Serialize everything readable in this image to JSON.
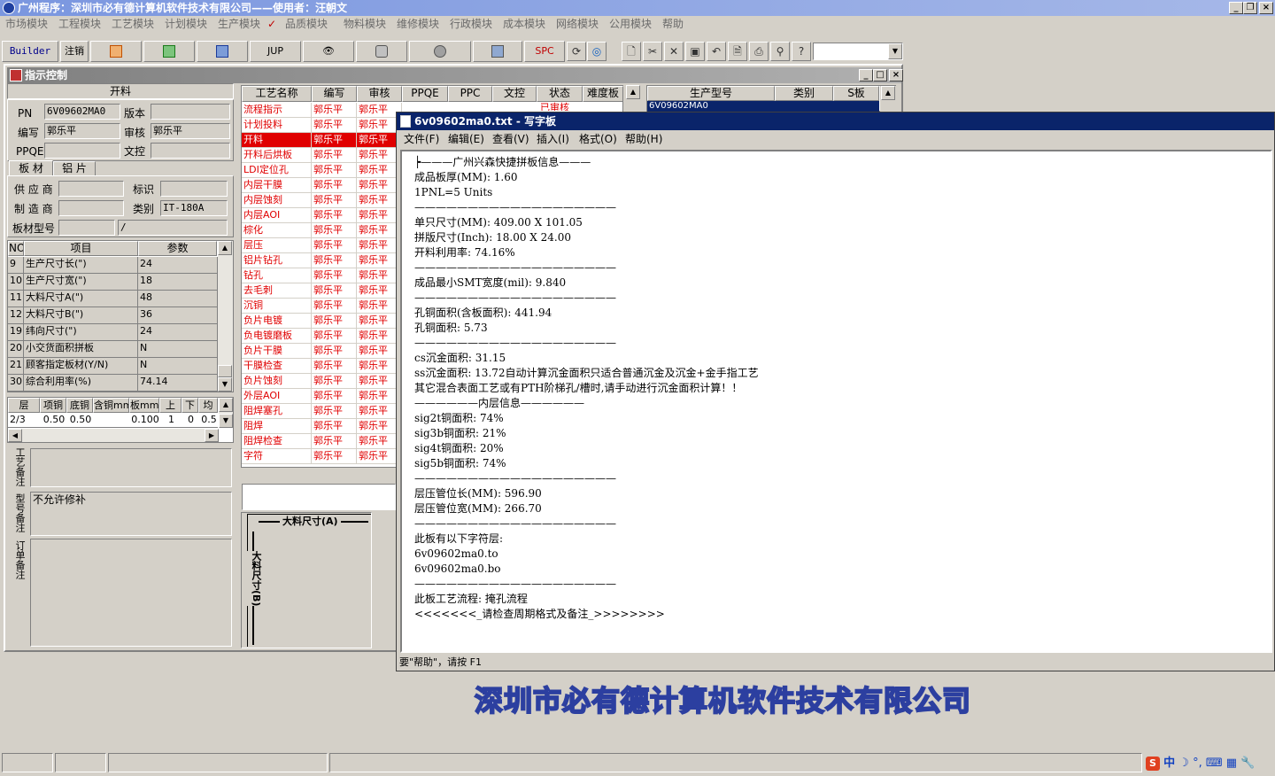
{
  "app": {
    "title": "广州程序：深圳市必有德计算机软件技术有限公司——使用者：汪朝文",
    "menu": [
      "市场模块",
      "工程模块",
      "工艺模块",
      "计划模块",
      "生产模块",
      "品质模块",
      "物料模块",
      "维修模块",
      "行政模块",
      "成本模块",
      "网络模块",
      "公用模块",
      "帮助"
    ]
  },
  "toolbar": {
    "builder_label": "Builder",
    "logout_label": "注销",
    "jup_label": "JUP",
    "spc_label": "SPC"
  },
  "child_window": {
    "title": "指示控制",
    "section_header": "开料",
    "pn_label": "PN",
    "pn_value": "6V09602MA0",
    "version_label": "版本",
    "version_value": "",
    "editor_label": "编写",
    "editor_value": "郭乐平",
    "reviewer_label": "审核",
    "reviewer_value": "郭乐平",
    "ppqe_label": "PPQE",
    "ppqe_value": "",
    "docctrl_label": "文控",
    "docctrl_value": "",
    "tab_board": "板 材",
    "tab_aluminum": "铝 片",
    "supplier_label": "供 应 商",
    "supplier_value": "",
    "mark_label": "标识",
    "mark_value": "",
    "maker_label": "制 造 商",
    "maker_value": "",
    "category_label": "类别",
    "category_value": "IT-180A",
    "model_label": "板材型号",
    "model_value": "",
    "model_value2": "/"
  },
  "params": {
    "headers": [
      "NO",
      "项目",
      "参数"
    ],
    "rows": [
      [
        "9",
        "生产尺寸长(\")",
        "24"
      ],
      [
        "10",
        "生产尺寸宽(\")",
        "18"
      ],
      [
        "11",
        "大料尺寸A(\")",
        "48"
      ],
      [
        "12",
        "大料尺寸B(\")",
        "36"
      ],
      [
        "19",
        "纬向尺寸(\")",
        "24"
      ],
      [
        "20",
        "小交货面积拼板",
        "N"
      ],
      [
        "21",
        "顾客指定板材(Y/N)",
        "N"
      ],
      [
        "30",
        "综合利用率(%)",
        "74.14"
      ]
    ]
  },
  "layers": {
    "headers": [
      "层",
      "项铜",
      "底铜",
      "含铜mm",
      "板mm",
      "上",
      "下",
      "均"
    ],
    "row": [
      "2/3",
      "0.50",
      "0.50",
      "",
      "0.100",
      "1",
      "0",
      "0.5"
    ]
  },
  "notes": {
    "process_note_label": "工艺备注",
    "model_note_label": "型号备注",
    "model_note_value": "不允许修补",
    "order_note_label": "订单备注"
  },
  "process_table": {
    "headers": [
      "工艺名称",
      "编写",
      "审核",
      "PPQE",
      "PPC",
      "文控",
      "状态",
      "难度板"
    ],
    "rows": [
      [
        "流程指示",
        "郭乐平",
        "郭乐平"
      ],
      [
        "计划投料",
        "郭乐平",
        "郭乐平"
      ],
      [
        "开料",
        "郭乐平",
        "郭乐平"
      ],
      [
        "开料后烘板",
        "郭乐平",
        "郭乐平"
      ],
      [
        "LDI定位孔",
        "郭乐平",
        "郭乐平"
      ],
      [
        "内层干膜",
        "郭乐平",
        "郭乐平"
      ],
      [
        "内层蚀刻",
        "郭乐平",
        "郭乐平"
      ],
      [
        "内层AOI",
        "郭乐平",
        "郭乐平"
      ],
      [
        "棕化",
        "郭乐平",
        "郭乐平"
      ],
      [
        "层压",
        "郭乐平",
        "郭乐平"
      ],
      [
        "铝片钻孔",
        "郭乐平",
        "郭乐平"
      ],
      [
        "钻孔",
        "郭乐平",
        "郭乐平"
      ],
      [
        "去毛刺",
        "郭乐平",
        "郭乐平"
      ],
      [
        "沉铜",
        "郭乐平",
        "郭乐平"
      ],
      [
        "负片电镀",
        "郭乐平",
        "郭乐平"
      ],
      [
        "负电镀磨板",
        "郭乐平",
        "郭乐平"
      ],
      [
        "负片干膜",
        "郭乐平",
        "郭乐平"
      ],
      [
        "干膜检查",
        "郭乐平",
        "郭乐平"
      ],
      [
        "负片蚀刻",
        "郭乐平",
        "郭乐平"
      ],
      [
        "外层AOI",
        "郭乐平",
        "郭乐平"
      ],
      [
        "阻焊塞孔",
        "郭乐平",
        "郭乐平"
      ],
      [
        "阻焊",
        "郭乐平",
        "郭乐平"
      ],
      [
        "阻焊检查",
        "郭乐平",
        "郭乐平"
      ],
      [
        "字符",
        "郭乐平",
        "郭乐平"
      ]
    ],
    "status_fragment": "已审核"
  },
  "diagram": {
    "dim_a": "大料尺寸(A)",
    "dim_b": "大料尺寸(B)"
  },
  "model_table": {
    "headers": [
      "生产型号",
      "类别",
      "S板"
    ],
    "first_row": "6V09602MA0"
  },
  "wordpad": {
    "title": "6v09602ma0.txt - 写字板",
    "menu": [
      "文件(F)",
      "编辑(E)",
      "查看(V)",
      "插入(I)",
      "格式(O)",
      "帮助(H)"
    ],
    "lines": [
      "┝———广州兴森快捷拼板信息———",
      "成品板厚(MM): 1.60",
      "1PNL=5 Units",
      "———————————————————",
      "单只尺寸(MM): 409.00 X 101.05",
      "拼版尺寸(Inch): 18.00 X 24.00",
      "开料利用率: 74.16%",
      "———————————————————",
      "成品最小SMT宽度(mil): 9.840",
      "———————————————————",
      "孔铜面积(含板面积): 441.94",
      "孔铜面积: 5.73",
      "———————————————————",
      "cs沉金面积: 31.15",
      "ss沉金面积: 13.72自动计算沉金面积只适合普通沉金及沉金+金手指工艺",
      "其它混合表面工艺或有PTH阶梯孔/槽时,请手动进行沉金面积计算！！",
      "——————内层信息——————",
      "sig2t铜面积: 74%",
      "sig3b铜面积: 21%",
      "sig4t铜面积: 20%",
      "sig5b铜面积: 74%",
      "———————————————————",
      "层压管位长(MM): 596.90",
      "层压管位宽(MM): 266.70",
      "———————————————————",
      "此板有以下字符层:",
      "6v09602ma0.to",
      "6v09602ma0.bo",
      "———————————————————",
      "此板工艺流程: 掩孔流程",
      "<<<<<<<_请检查周期格式及备注_>>>>>>>>"
    ],
    "status": "要\"帮助\"，请按 F1"
  },
  "banner": "深圳市必有德计算机软件技术有限公司",
  "tray": {
    "ime_label": "中"
  },
  "colors": {
    "accent_red": "#e00000",
    "title_blue": "#0a246a",
    "banner_outline": "#2c3fa0"
  }
}
